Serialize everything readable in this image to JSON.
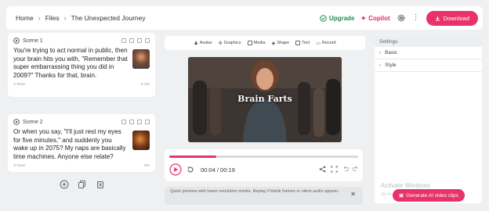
{
  "breadcrumb": [
    "Home",
    "Files",
    "The Unexpected Journey"
  ],
  "header": {
    "upgrade_label": "Upgrade",
    "copilot_label": "Copilot",
    "download_label": "Download"
  },
  "scenes": [
    {
      "title": "Scene 1",
      "text": "You're trying to act normal in public, then your brain hits you with, \"Remember that super embarrassing thing you did in 2009?\" Thanks for that, brain.",
      "voice": "Rose",
      "duration": "6.70s"
    },
    {
      "title": "Scene 2",
      "text": "Or when you say, \"I'll just rest my eyes for five minutes,\" and suddenly you wake up in 2075? My naps are basically time machines. Anyone else relate?",
      "voice": "Rose",
      "duration": "20s"
    }
  ],
  "toolbar": {
    "items": [
      "Avatar",
      "Graphics",
      "Media",
      "Shape",
      "Text",
      "Record"
    ]
  },
  "video": {
    "title": "Brain Farts"
  },
  "player": {
    "time": "00:04 / 00:19",
    "progress": 0.25
  },
  "notice": {
    "text": "Quick preview with lower resolution media. Replay if blank frames or silent audio appear."
  },
  "settings": {
    "title": "Settings",
    "sections": [
      "Basic",
      "Style"
    ]
  },
  "watermark": {
    "line1": "Activate Windows",
    "line2": "Go to Settings to activate Windows."
  },
  "generate_label": "Generate AI video clips",
  "colors": {
    "accent": "#e8336a",
    "upgrade": "#1f8a4c",
    "background": "#eef0f2"
  }
}
